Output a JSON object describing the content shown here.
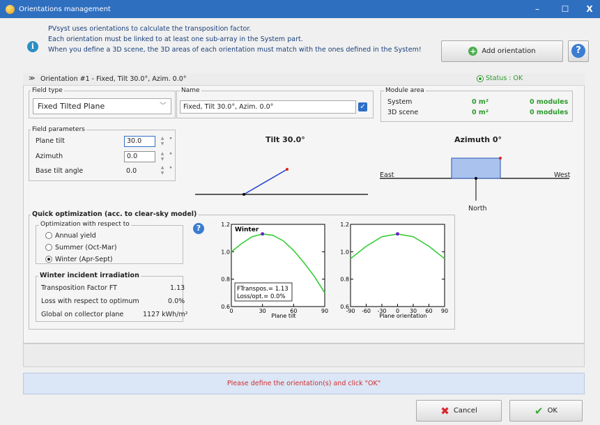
{
  "window": {
    "title": "Orientations management",
    "controls": {
      "minimize": "–",
      "maximize": "☐",
      "close": "X"
    }
  },
  "info": {
    "lines": [
      "PVsyst uses orientations to calculate the transposition factor.",
      "Each orientation must be linked to at least one sub-array in the System part.",
      "When you define a 3D scene, the 3D areas of each orientation must match with the ones defined in the System!"
    ]
  },
  "toolbar": {
    "add_orientation": "Add orientation",
    "help": "?"
  },
  "orientation": {
    "title": "Orientation #1 - Fixed, Tilt 30.0°, Azim. 0.0°",
    "status": "Status : OK",
    "field_type": {
      "label": "Field type",
      "value": "Fixed Tilted Plane"
    },
    "name": {
      "label": "Name",
      "value": "Fixed, Tilt 30.0°, Azim. 0.0°",
      "checked": true
    },
    "module_area": {
      "label": "Module area",
      "rows": [
        {
          "label": "System",
          "area": "0 m²",
          "modules": "0 modules"
        },
        {
          "label": "3D scene",
          "area": "0 m²",
          "modules": "0 modules"
        }
      ]
    },
    "field_parameters": {
      "label": "Field parameters",
      "plane_tilt": {
        "label": "Plane tilt",
        "value": "30.0"
      },
      "azimuth": {
        "label": "Azimuth",
        "value": "0.0"
      },
      "base_tilt": {
        "label": "Base tilt angle",
        "value": "0.0"
      },
      "unit": "°"
    },
    "tilt_diagram": {
      "title": "Tilt 30.0°"
    },
    "azimuth_diagram": {
      "title": "Azimuth 0°",
      "east": "East",
      "west": "West",
      "north": "North"
    }
  },
  "quick_opt": {
    "title": "Quick optimization (acc. to clear-sky model)",
    "group_label": "Optimization with respect to",
    "options": [
      "Annual yield",
      "Summer (Oct-Mar)",
      "Winter (Apr-Sept)"
    ],
    "selected": 2,
    "help": "?",
    "irradiation": {
      "title": "Winter incident irradiation",
      "rows": [
        {
          "label": "Transposition Factor FT",
          "value": "1.13"
        },
        {
          "label": "Loss with respect to optimum",
          "value": "0.0%"
        },
        {
          "label": "Global on collector plane",
          "value": "1127 kWh/m²"
        }
      ]
    }
  },
  "chart_data": [
    {
      "type": "line",
      "title": "Winter",
      "xlabel": "Plane tilt",
      "ylabel": "",
      "xlim": [
        0,
        90
      ],
      "ylim": [
        0.6,
        1.2
      ],
      "xticks": [
        0,
        30,
        60,
        90
      ],
      "yticks": [
        0.6,
        0.8,
        1.0,
        1.2
      ],
      "x": [
        0,
        10,
        20,
        30,
        40,
        50,
        60,
        70,
        80,
        90
      ],
      "y": [
        1.0,
        1.06,
        1.11,
        1.13,
        1.12,
        1.08,
        1.01,
        0.92,
        0.82,
        0.7
      ],
      "marker": {
        "x": 30,
        "y": 1.13
      },
      "annotation": [
        "FTranspos.= 1.13",
        "Loss/opt.= 0.0%"
      ],
      "color": "#33cc33"
    },
    {
      "type": "line",
      "xlabel": "Plane orientation",
      "ylabel": "",
      "xlim": [
        -90,
        90
      ],
      "ylim": [
        0.6,
        1.2
      ],
      "xticks": [
        -90,
        -60,
        -30,
        0,
        30,
        60,
        90
      ],
      "yticks": [
        0.6,
        0.8,
        1.0,
        1.2
      ],
      "x": [
        -90,
        -60,
        -30,
        0,
        30,
        60,
        90
      ],
      "y": [
        0.95,
        1.04,
        1.11,
        1.13,
        1.11,
        1.04,
        0.95
      ],
      "marker": {
        "x": 0,
        "y": 1.13
      },
      "color": "#33cc33"
    }
  ],
  "footer": {
    "message": "Please define the orientation(s) and click \"OK\"",
    "cancel": "Cancel",
    "ok": "OK"
  }
}
